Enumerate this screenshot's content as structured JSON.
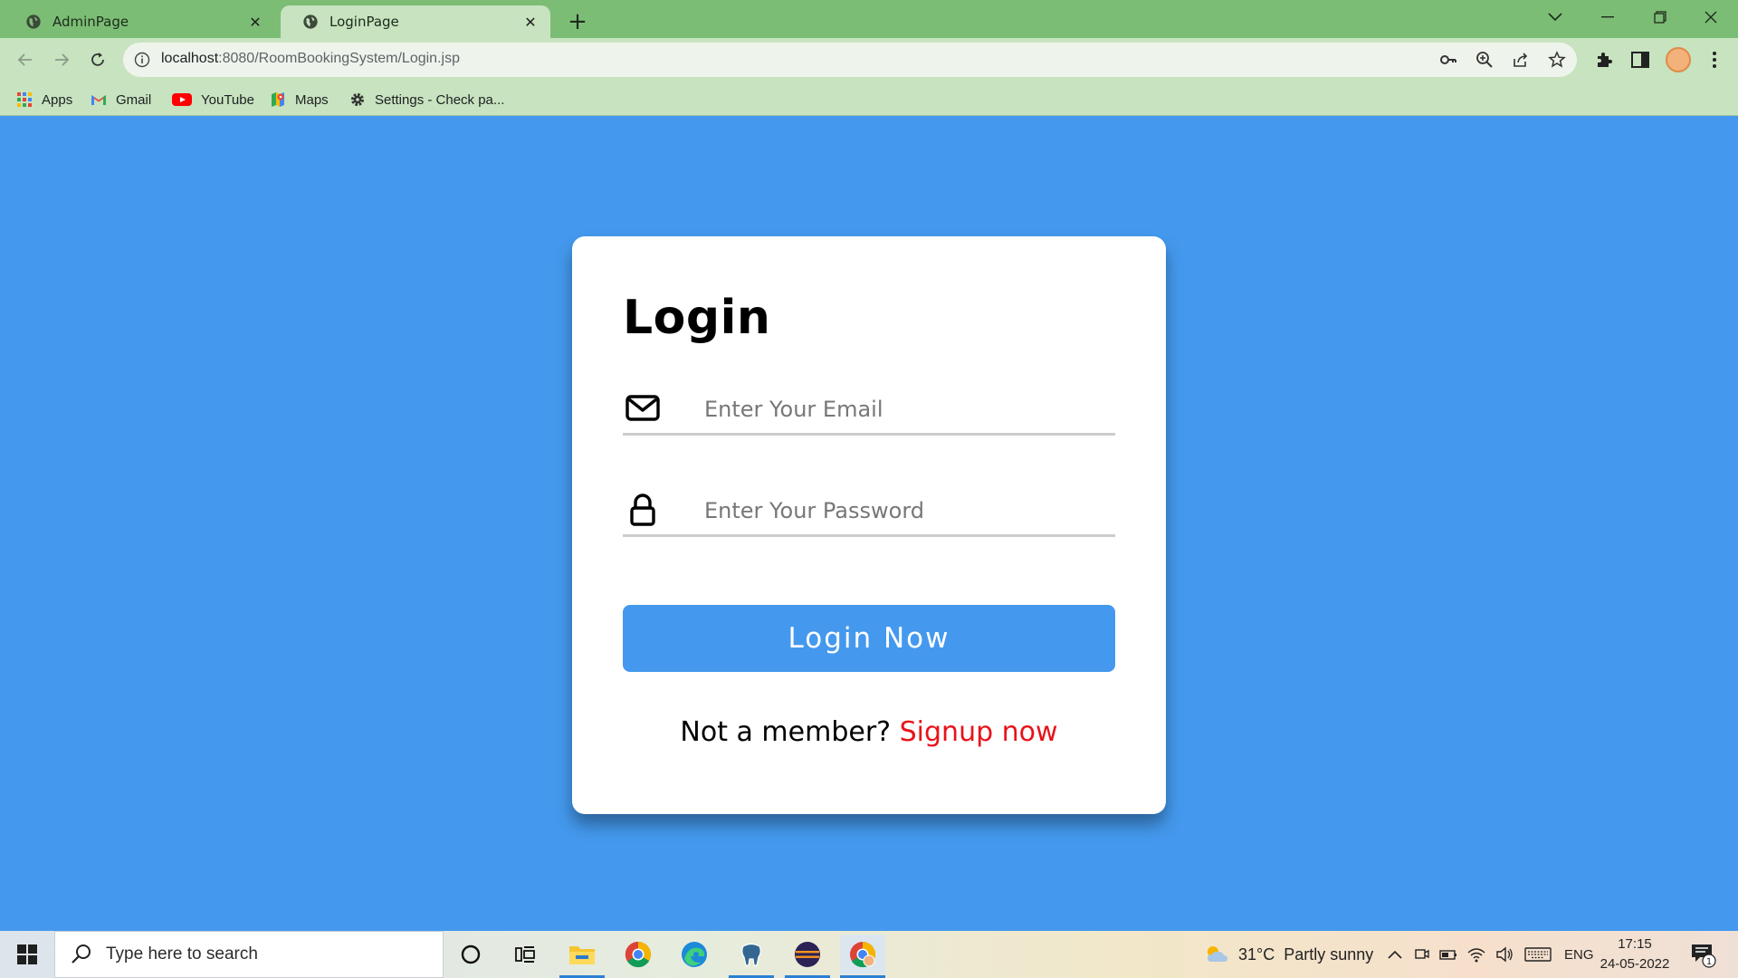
{
  "browser": {
    "tabs": [
      {
        "title": "AdminPage",
        "active": false
      },
      {
        "title": "LoginPage",
        "active": true
      }
    ],
    "url_host": "localhost",
    "url_path": ":8080/RoomBookingSystem/Login.jsp",
    "bookmarks": [
      {
        "label": "Apps",
        "icon": "apps-grid-icon"
      },
      {
        "label": "Gmail",
        "icon": "gmail-icon"
      },
      {
        "label": "YouTube",
        "icon": "youtube-icon"
      },
      {
        "label": "Maps",
        "icon": "maps-icon"
      },
      {
        "label": "Settings - Check pa...",
        "icon": "settings-gear-icon"
      }
    ]
  },
  "login": {
    "title": "Login",
    "email_placeholder": "Enter Your Email",
    "password_placeholder": "Enter Your Password",
    "button_label": "Login Now",
    "signup_prompt": "Not a member?",
    "signup_link": "Signup now"
  },
  "colors": {
    "page_background": "#4499ee",
    "button_background": "#4499ee",
    "signup_link": "#e8131a",
    "tab_strip": "#7cbd75",
    "toolbar": "#c7e3bf"
  },
  "taskbar": {
    "search_placeholder": "Type here to search",
    "weather_temp": "31°C",
    "weather_desc": "Partly sunny",
    "language": "ENG",
    "time": "17:15",
    "date": "24-05-2022",
    "notification_count": "1"
  }
}
